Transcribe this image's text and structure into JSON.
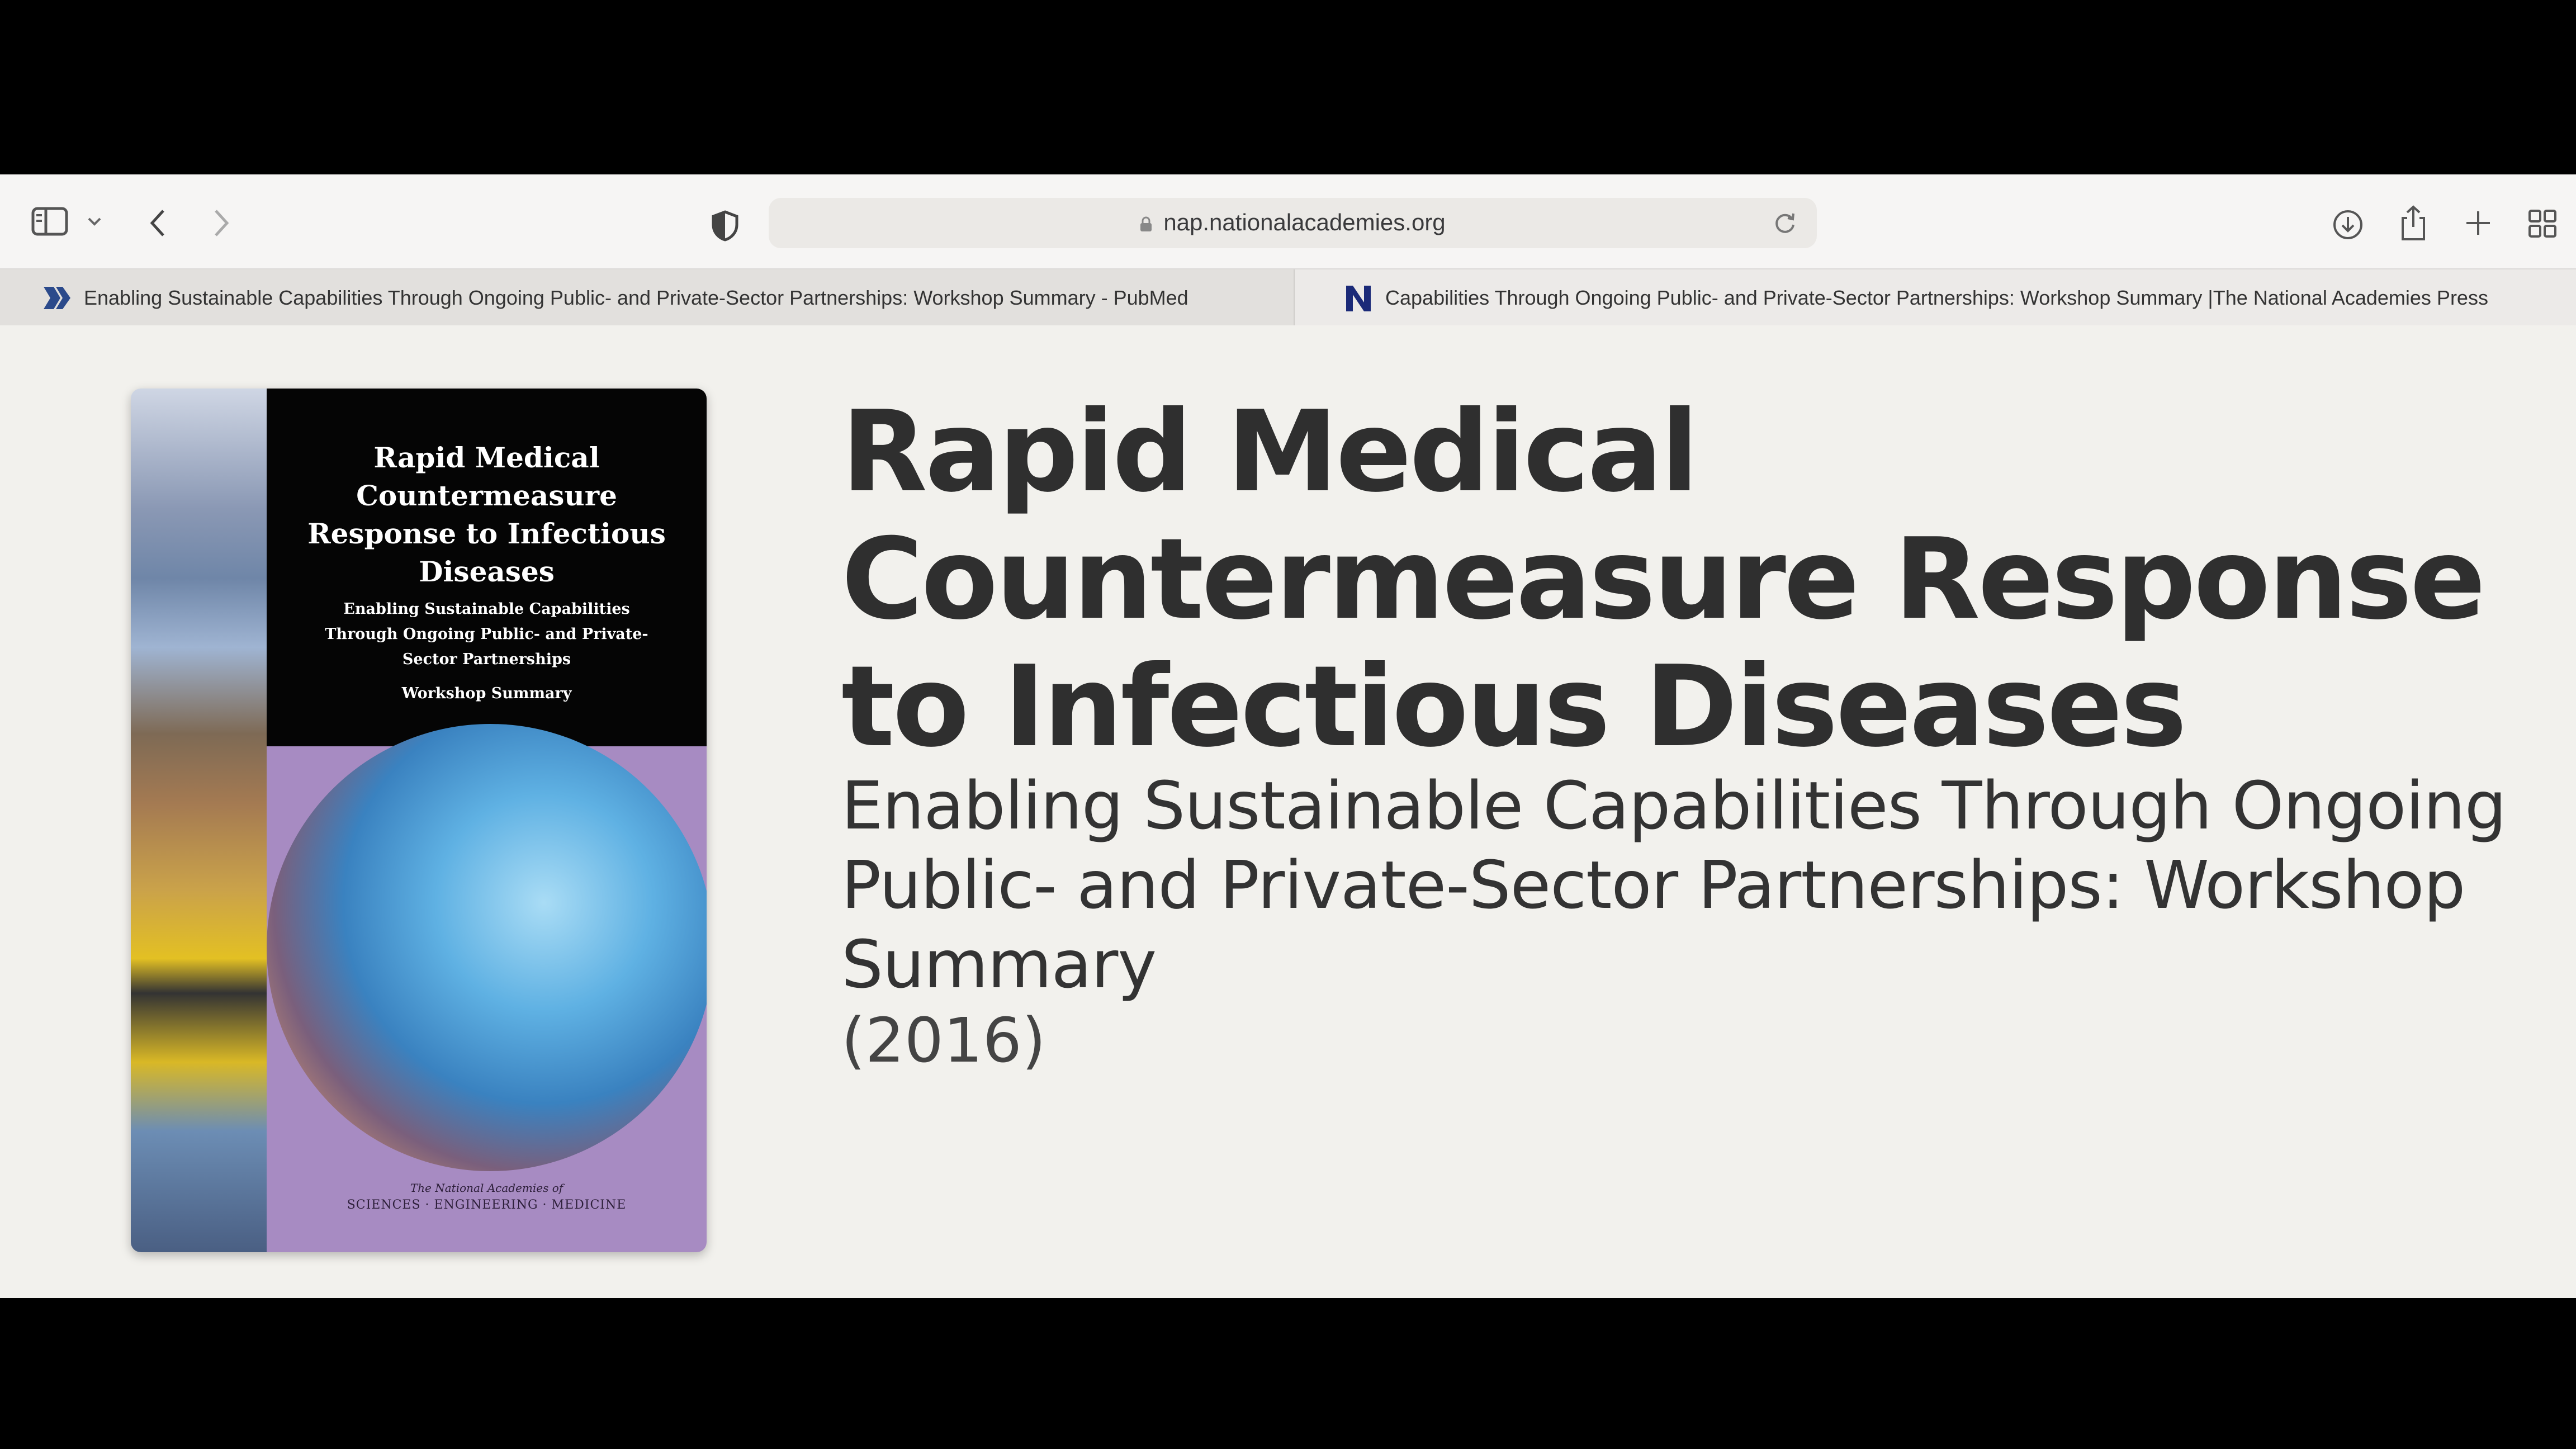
{
  "browser": {
    "url": "nap.nationalacademies.org"
  },
  "tabs": [
    {
      "label": "Enabling Sustainable Capabilities Through Ongoing Public- and Private-Sector Partnerships: Workshop Summary - PubMed",
      "favicon": "pubmed-icon"
    },
    {
      "label": "Capabilities Through Ongoing Public- and Private-Sector Partnerships: Workshop Summary |The National Academies Press",
      "favicon": "nap-n-icon"
    }
  ],
  "cover": {
    "title": "Rapid Medical Countermeasure Response to Infectious Diseases",
    "subtitle": "Enabling Sustainable Capabilities Through Ongoing Public- and Private-Sector Partnerships",
    "workshop": "Workshop Summary",
    "publisher_line1": "The National Academies of",
    "publisher_line2": "SCIENCES · ENGINEERING · MEDICINE"
  },
  "page": {
    "title": "Rapid Medical Countermeasure Response to Infectious Diseases",
    "subtitle": "Enabling Sustainable Capabilities Through Ongoing Public- and Private-Sector Partnerships: Workshop Summary",
    "year": "(2016)"
  },
  "colors": {
    "nap_n": "#1b2a78",
    "pubmed": "#2b4a8b"
  }
}
